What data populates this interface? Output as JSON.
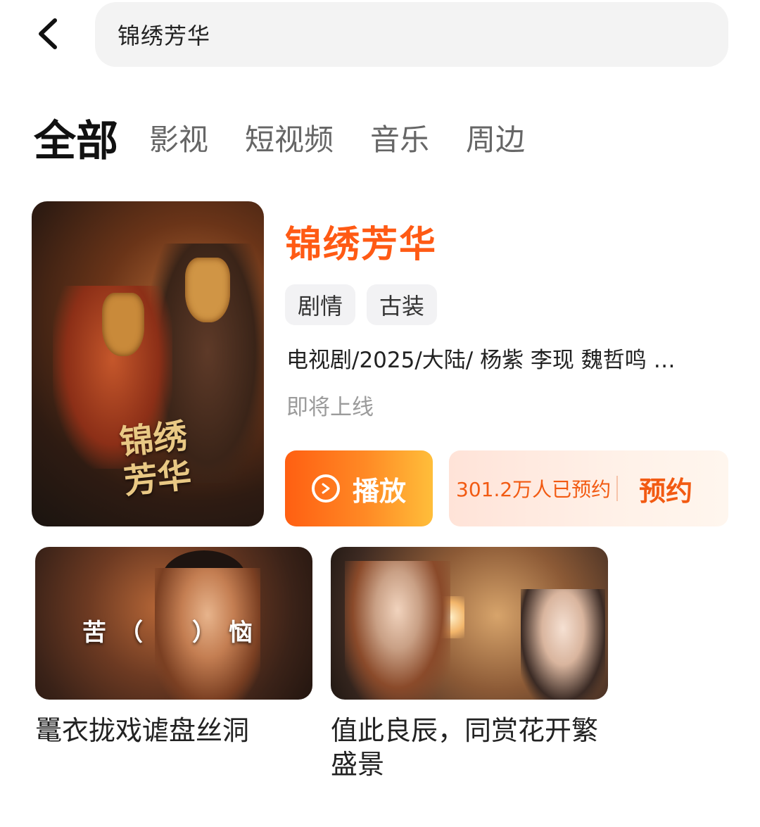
{
  "header": {
    "back_icon": "chevron-left-icon",
    "search_query": "锦绣芳华"
  },
  "tabs": [
    {
      "label": "全部",
      "active": true
    },
    {
      "label": "影视",
      "active": false
    },
    {
      "label": "短视频",
      "active": false
    },
    {
      "label": "音乐",
      "active": false
    },
    {
      "label": "周边",
      "active": false
    }
  ],
  "result": {
    "poster_text": "锦绣芳华",
    "title": "锦绣芳华",
    "tags": [
      "剧情",
      "古装"
    ],
    "meta": "电视剧/2025/大陆/ 杨紫 李现 魏哲鸣 …",
    "status": "即将上线",
    "play_label": "播放",
    "reserve_count": "301.2万人已预约",
    "reserve_label": "预约",
    "accent_color": "#ff5a14"
  },
  "videos": [
    {
      "thumb_caption": "苦（　）恼",
      "title": "鼍衣拢戏谑盘丝洞"
    },
    {
      "title": "值此良辰，同赏花开繁盛景"
    }
  ]
}
